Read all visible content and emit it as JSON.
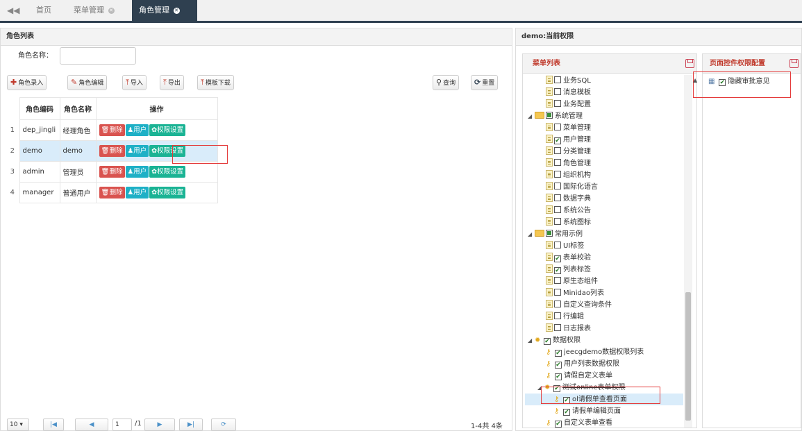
{
  "tabs": {
    "prev_icon": "double-chevron-left-icon",
    "home": "首页",
    "menu_mgmt": "菜单管理",
    "role_mgmt": "角色管理"
  },
  "left_panel": {
    "title": "角色列表",
    "search_label": "角色名称：",
    "search_value": "",
    "toolbar": {
      "add": "角色录入",
      "edit": "角色编辑",
      "import": "导入",
      "export": "导出",
      "template": "模板下载",
      "query": "查询",
      "reset": "重置"
    },
    "columns": [
      "角色编码",
      "角色名称",
      "操作"
    ],
    "rows": [
      {
        "n": "1",
        "code": "dep_jingli",
        "name": "经理角色"
      },
      {
        "n": "2",
        "code": "demo",
        "name": "demo"
      },
      {
        "n": "3",
        "code": "admin",
        "name": "管理员"
      },
      {
        "n": "4",
        "code": "manager",
        "name": "普通用户"
      }
    ],
    "ops": {
      "delete": "删除",
      "user": "用户",
      "perm": "权限设置"
    },
    "pager": {
      "page_size": "10",
      "page": "1",
      "total_pages": "/1",
      "summary": "1-4共 4条"
    }
  },
  "right_panel": {
    "title": "demo:当前权限",
    "menu_list_title": "菜单列表",
    "control_title": "页面控件权限配置",
    "control_item": "隐藏审批意见",
    "tree": [
      {
        "label": "业务SQL",
        "icon": "file",
        "checked": false
      },
      {
        "label": "消息模板",
        "icon": "file",
        "checked": false
      },
      {
        "label": "业务配置",
        "icon": "file",
        "checked": false
      },
      {
        "label": "系统管理",
        "icon": "folder",
        "checked": "partial"
      },
      {
        "label": "菜单管理",
        "icon": "file",
        "checked": false
      },
      {
        "label": "用户管理",
        "icon": "file",
        "checked": true
      },
      {
        "label": "分类管理",
        "icon": "file",
        "checked": false
      },
      {
        "label": "角色管理",
        "icon": "file",
        "checked": false
      },
      {
        "label": "组织机构",
        "icon": "file",
        "checked": false
      },
      {
        "label": "国际化语言",
        "icon": "file",
        "checked": false
      },
      {
        "label": "数据字典",
        "icon": "file",
        "checked": false
      },
      {
        "label": "系统公告",
        "icon": "file",
        "checked": false
      },
      {
        "label": "系统图标",
        "icon": "file",
        "checked": false
      },
      {
        "label": "常用示例",
        "icon": "folder",
        "checked": "partial"
      },
      {
        "label": "UI标签",
        "icon": "file",
        "checked": false
      },
      {
        "label": "表单校验",
        "icon": "file",
        "checked": true
      },
      {
        "label": "列表标签",
        "icon": "file",
        "checked": true
      },
      {
        "label": "原生态组件",
        "icon": "file",
        "checked": false
      },
      {
        "label": "Minidao列表",
        "icon": "file",
        "checked": false
      },
      {
        "label": "自定义查询条件",
        "icon": "file",
        "checked": false
      },
      {
        "label": "行编辑",
        "icon": "file",
        "checked": false
      },
      {
        "label": "日志报表",
        "icon": "file",
        "checked": false
      },
      {
        "label": "数据权限",
        "icon": "gear",
        "checked": true
      },
      {
        "label": "jeecgdemo数据权限列表",
        "icon": "key",
        "checked": true
      },
      {
        "label": "用户列表数据权限",
        "icon": "key",
        "checked": true
      },
      {
        "label": "请假自定义表单",
        "icon": "key",
        "checked": true
      },
      {
        "label": "测试online表单权限",
        "icon": "gear",
        "checked": true
      },
      {
        "label": "ol请假单查看页面",
        "icon": "key",
        "checked": true
      },
      {
        "label": "请假单编辑页面",
        "icon": "key",
        "checked": true
      },
      {
        "label": "自定义表单查看",
        "icon": "key",
        "checked": true
      }
    ]
  },
  "colors": {
    "dark_header": "#2f4050",
    "delete": "#d9534f",
    "user": "#1eb0c6",
    "perm": "#1ab394",
    "highlight": "#e43a3a"
  }
}
